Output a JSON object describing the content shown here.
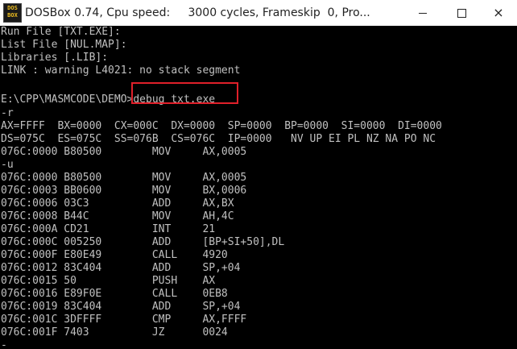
{
  "window": {
    "title": "DOSBox 0.74, Cpu speed:     3000 cycles, Frameskip  0, Pro...",
    "icon_text_top": "DOS",
    "icon_text_bottom": "BOX",
    "icon": "dosbox-icon",
    "controls": {
      "minimize": "minimize-icon",
      "maximize": "maximize-icon",
      "close": "×"
    }
  },
  "colors": {
    "terminal_bg": "#000000",
    "terminal_fg": "#c0c0c0",
    "highlight": "#e0202a"
  },
  "terminal": {
    "lines": [
      "Run File [TXT.EXE]:",
      "List File [NUL.MAP]:",
      "Libraries [.LIB]:",
      "LINK : warning L4021: no stack segment",
      "",
      "E:\\CPP\\MASMCODE\\DEMO>debug txt.exe",
      "-r",
      "AX=FFFF  BX=0000  CX=000C  DX=0000  SP=0000  BP=0000  SI=0000  DI=0000",
      "DS=075C  ES=075C  SS=076B  CS=076C  IP=0000   NV UP EI PL NZ NA PO NC",
      "076C:0000 B80500        MOV     AX,0005",
      "-u",
      "076C:0000 B80500        MOV     AX,0005",
      "076C:0003 BB0600        MOV     BX,0006",
      "076C:0006 03C3          ADD     AX,BX",
      "076C:0008 B44C          MOV     AH,4C",
      "076C:000A CD21          INT     21",
      "076C:000C 005250        ADD     [BP+SI+50],DL",
      "076C:000F E80E49        CALL    4920",
      "076C:0012 83C404        ADD     SP,+04",
      "076C:0015 50            PUSH    AX",
      "076C:0016 E89F0E        CALL    0EB8",
      "076C:0019 83C404        ADD     SP,+04",
      "076C:001C 3DFFFF        CMP     AX,FFFF",
      "076C:001F 7403          JZ      0024",
      "-"
    ]
  }
}
